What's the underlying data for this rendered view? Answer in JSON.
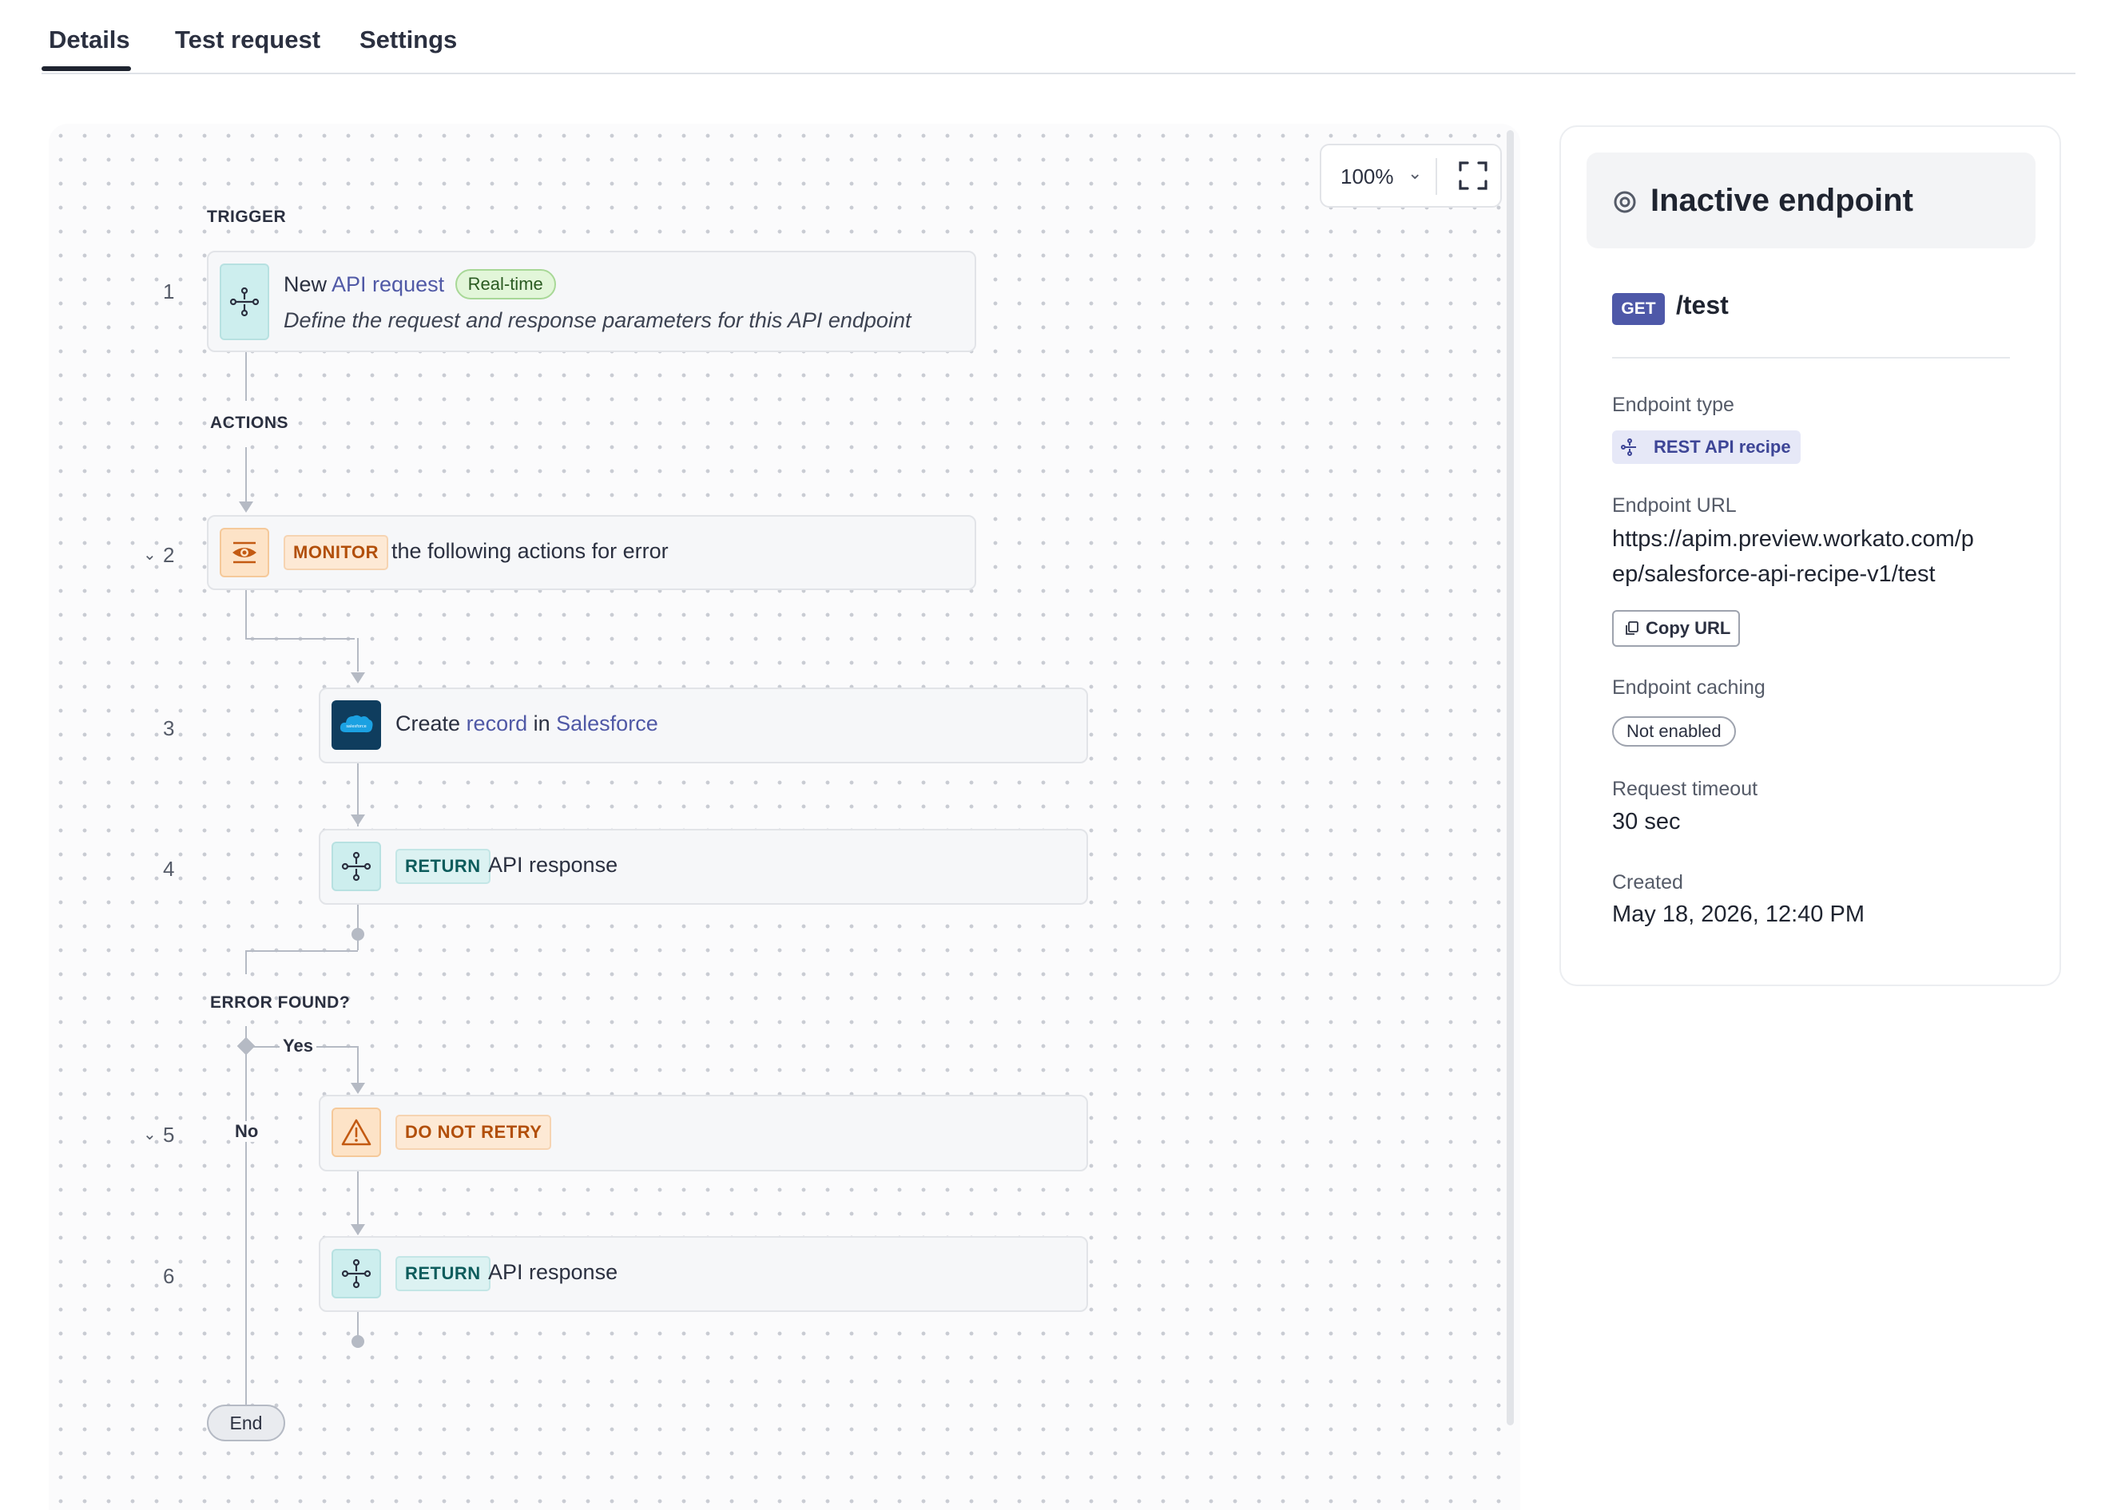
{
  "tabs": [
    {
      "label": "Details",
      "active": true
    },
    {
      "label": "Test request",
      "active": false
    },
    {
      "label": "Settings",
      "active": false
    }
  ],
  "canvas": {
    "zoom": "100%",
    "trigger_label": "TRIGGER",
    "actions_label": "ACTIONS",
    "error_label": "ERROR FOUND?",
    "yes_label": "Yes",
    "no_label": "No",
    "end_label": "End"
  },
  "steps": {
    "s1": {
      "num": "1",
      "prefix": "New",
      "link": "API request",
      "pill": "Real-time",
      "description": "Define the request and response parameters for this API endpoint",
      "icon": "api-flow-icon"
    },
    "s2": {
      "num": "2",
      "tag": "MONITOR",
      "text": "the following actions for error",
      "icon": "eye-icon"
    },
    "s3": {
      "num": "3",
      "prefix": "Create",
      "link1": "record",
      "mid": "in",
      "link2": "Salesforce",
      "icon": "salesforce-icon"
    },
    "s4": {
      "num": "4",
      "tag": "RETURN",
      "text": "API response",
      "icon": "api-flow-icon"
    },
    "s5": {
      "num": "5",
      "tag": "DO NOT RETRY",
      "icon": "warning-icon"
    },
    "s6": {
      "num": "6",
      "tag": "RETURN",
      "text": "API response",
      "icon": "api-flow-icon"
    }
  },
  "panel": {
    "status": "Inactive endpoint",
    "method": "GET",
    "path": "/test",
    "endpoint_type_label": "Endpoint type",
    "endpoint_type_value": "REST API recipe",
    "endpoint_url_label": "Endpoint URL",
    "endpoint_url_line1": "https://apim.preview.workato.com/p",
    "endpoint_url_line2": "ep/salesforce-api-recipe-v1/test",
    "copy_url": "Copy URL",
    "caching_label": "Endpoint caching",
    "caching_value": "Not enabled",
    "timeout_label": "Request timeout",
    "timeout_value": "30 sec",
    "created_label": "Created",
    "created_value": "May 18, 2026, 12:40 PM"
  },
  "colors": {
    "accent": "#4e58a8",
    "link": "#5059a6",
    "monitor": "#b24f0a",
    "return": "#0d5c5c",
    "realtime": "#2a5a21"
  }
}
